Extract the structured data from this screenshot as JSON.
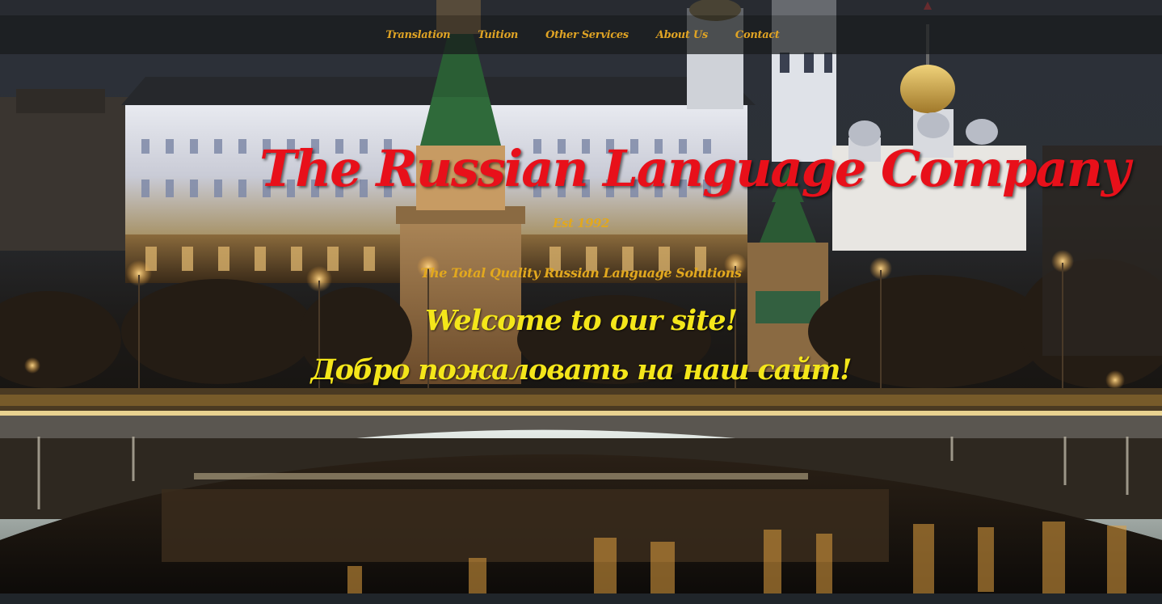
{
  "nav": {
    "items": [
      {
        "label": "Translation"
      },
      {
        "label": "Tuition"
      },
      {
        "label": "Other Services"
      },
      {
        "label": "About Us"
      },
      {
        "label": "Contact"
      }
    ]
  },
  "hero": {
    "title": "The Russian Language Company",
    "established": "Est 1992",
    "tagline": "The Total Quality Russian Language Solutions",
    "welcome_en": "Welcome to our site!",
    "welcome_ru": "Добро пожаловать на наш сайт!"
  },
  "colors": {
    "nav_text": "#e0a424",
    "title": "#e8101a",
    "subtitle": "#e2a81e",
    "welcome": "#f4e61a",
    "nav_bg": "#181a1c"
  },
  "background": {
    "icon": "moscow-kremlin-night-photo"
  }
}
